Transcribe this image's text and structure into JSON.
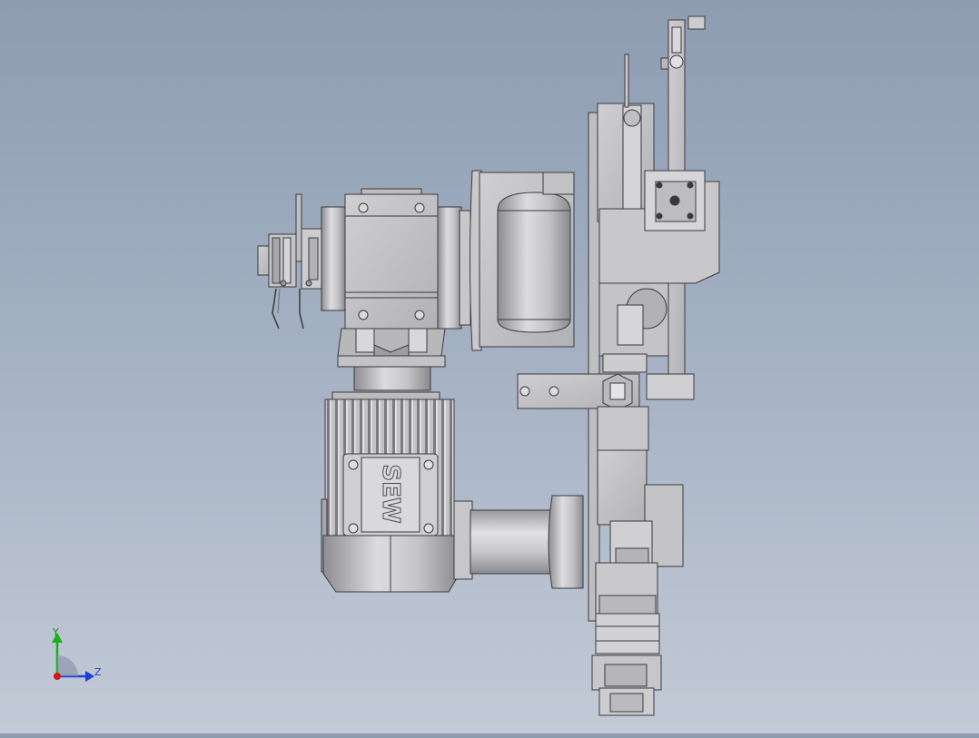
{
  "viewport": {
    "motor_brand": "SEW",
    "colors": {
      "background_top": "#8d9cb1",
      "background_bottom": "#c2cad6",
      "metal_light": "#d4d4d6",
      "metal_mid": "#b8b8bb",
      "metal_dark": "#8e8e92",
      "outline": "#3a3a3e"
    }
  },
  "triad": {
    "y_label": "Y",
    "z_label": "Z",
    "colors": {
      "y_axis": "#16b01a",
      "z_axis": "#1c3fd6",
      "x_axis": "#d01818"
    }
  }
}
